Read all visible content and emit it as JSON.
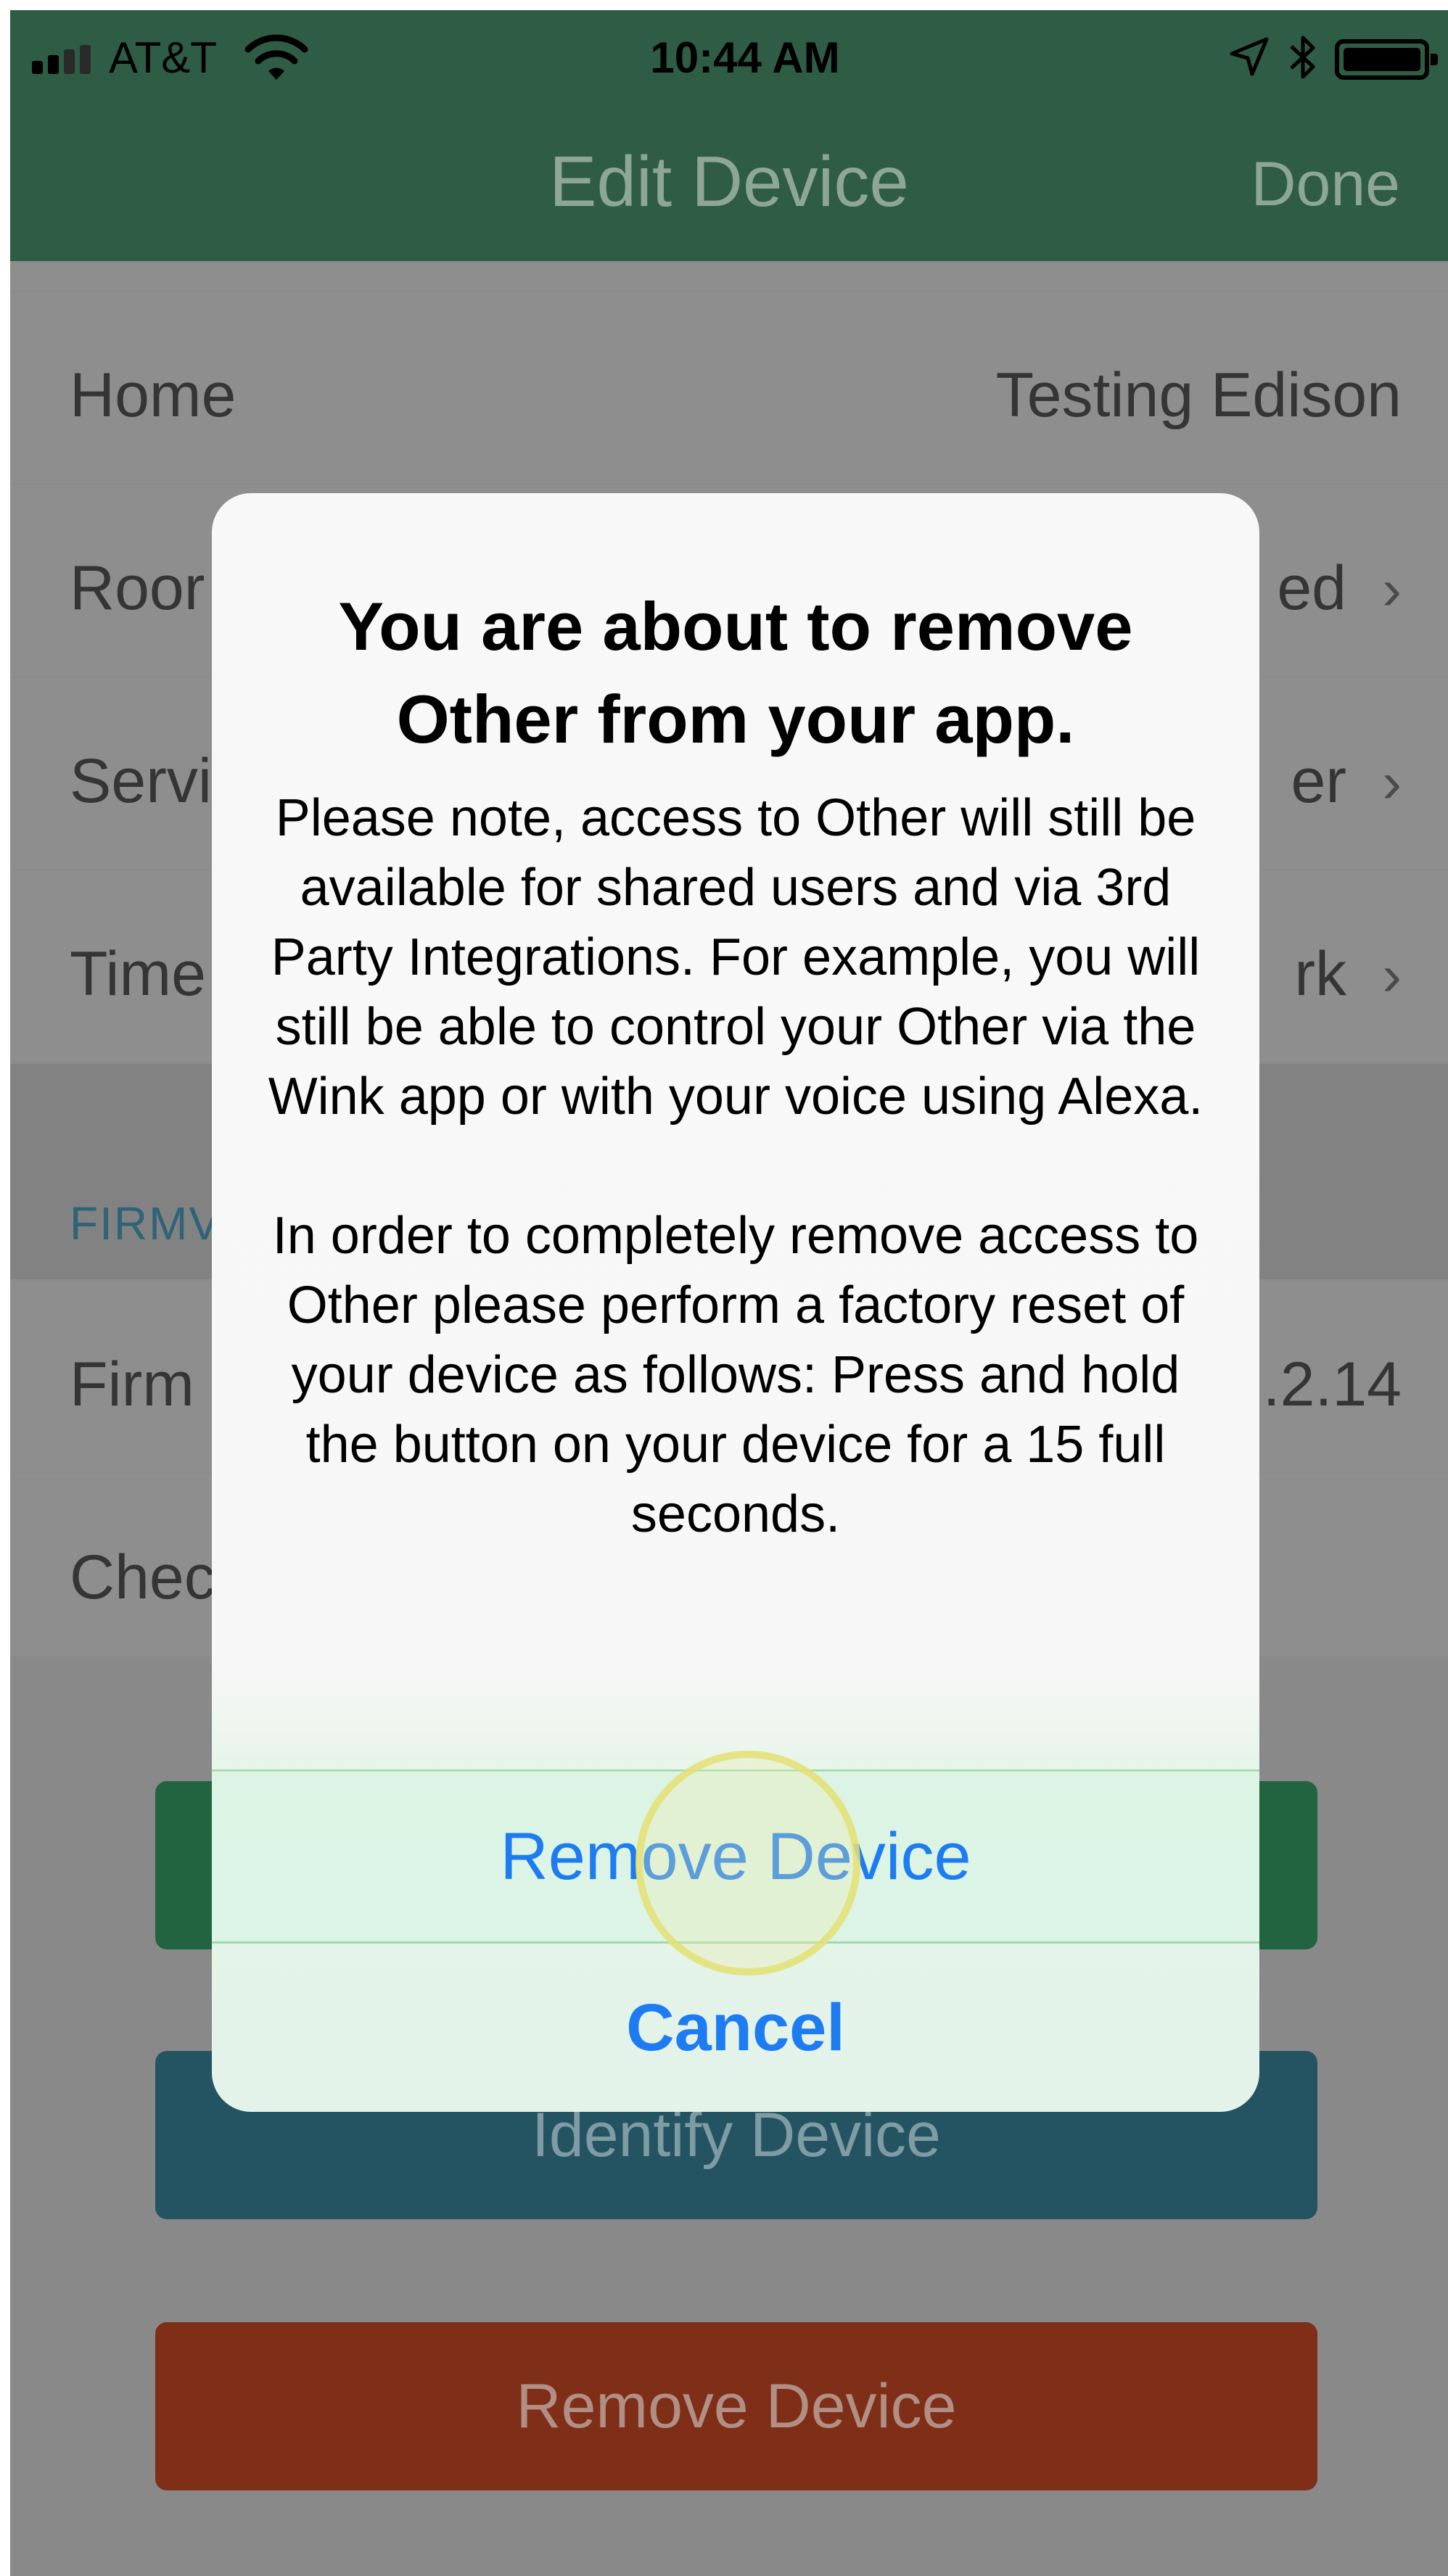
{
  "status_bar": {
    "carrier": "AT&T",
    "time": "10:44 AM"
  },
  "nav": {
    "title": "Edit Device",
    "done": "Done"
  },
  "rows": {
    "home": {
      "label": "Home",
      "value": "Testing Edison"
    },
    "room": {
      "label": "Roor",
      "value": "ed"
    },
    "service": {
      "label": "Servi",
      "value": "er"
    },
    "time": {
      "label": "Time",
      "value": "rk"
    },
    "firmware_section": "FIRMV",
    "firmware": {
      "label": "Firm",
      "value": ".2.14"
    },
    "check": {
      "label": "Chec"
    }
  },
  "buttons": {
    "identify": "Identify Device",
    "remove": "Remove Device"
  },
  "alert": {
    "title": "You are about to remove Other from your app.",
    "message_1": "Please note, access to Other will still be available for shared users and via 3rd Party Integrations. For example, you will still be able to control your Other via the Wink app or with your voice using Alexa.",
    "message_2": "In order to completely remove access to Other please perform a factory reset of your device as follows: Press and hold the button on your device for a 15 full seconds.",
    "remove_button": "Remove Device",
    "cancel_button": "Cancel"
  },
  "colors": {
    "nav_bar": "#2f5c45",
    "alert_action": "#1d7cf1",
    "identify_button": "#245462",
    "remove_button": "#7f2e18",
    "green_button": "#226340"
  },
  "icons": [
    "signal-icon",
    "wifi-icon",
    "location-arrow-icon",
    "bluetooth-icon",
    "battery-icon",
    "chevron-right-icon"
  ]
}
